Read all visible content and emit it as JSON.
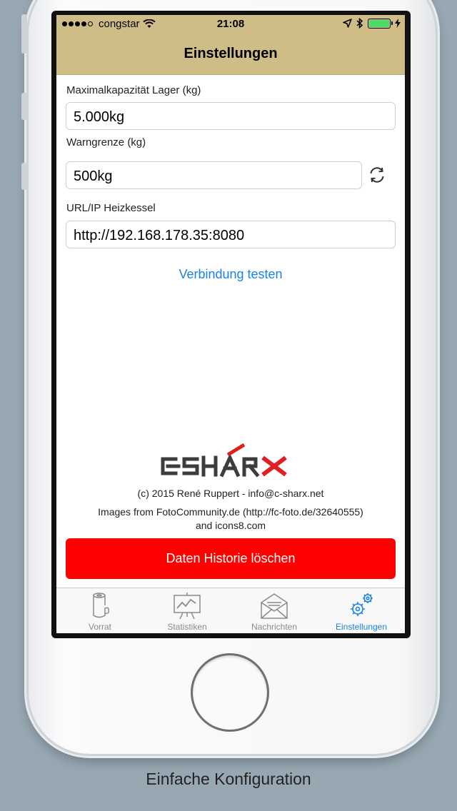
{
  "status_bar": {
    "carrier": "congstar",
    "time": "21:08"
  },
  "nav": {
    "title": "Einstellungen"
  },
  "form": {
    "capacity_label": "Maximalkapazität Lager (kg)",
    "capacity_value": "5.000kg",
    "warning_label": "Warngrenze (kg)",
    "warning_value": "500kg",
    "url_label": "URL/IP Heizkessel",
    "url_value": "http://192.168.178.35:8080",
    "test_link": "Verbindung testen"
  },
  "footer": {
    "copyright": "(c) 2015 René Ruppert - info@c-sharx.net",
    "images_credit_line1": "Images from FotoCommunity.de (http://fc-foto.de/32640555)",
    "images_credit_line2": "and icons8.com",
    "delete_button": "Daten Historie löschen"
  },
  "tabs": [
    {
      "label": "Vorrat",
      "icon": "wood-log-icon",
      "active": false
    },
    {
      "label": "Statistiken",
      "icon": "chart-board-icon",
      "active": false
    },
    {
      "label": "Nachrichten",
      "icon": "envelope-icon",
      "active": false
    },
    {
      "label": "Einstellungen",
      "icon": "gears-icon",
      "active": true
    }
  ],
  "colors": {
    "nav_background": "#cfbd88",
    "accent": "#1a82e0",
    "danger": "#ff0000",
    "page_background": "#97a8b3"
  },
  "caption": "Einfache Konfiguration"
}
